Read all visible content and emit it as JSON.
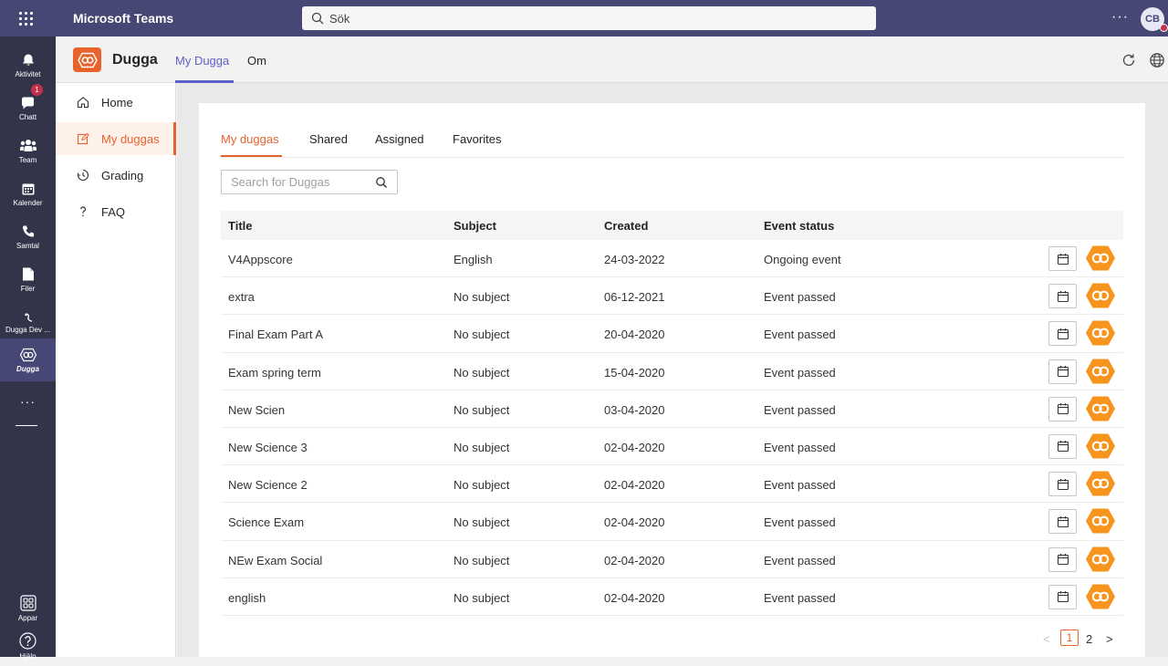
{
  "topbar": {
    "app_title": "Microsoft Teams",
    "search_placeholder": "Sök",
    "more": "···",
    "avatar_initials": "CB"
  },
  "rail": {
    "items": [
      {
        "label": "Aktivitet",
        "icon": "bell-icon"
      },
      {
        "label": "Chatt",
        "icon": "chat-icon",
        "badge": "1"
      },
      {
        "label": "Team",
        "icon": "team-icon"
      },
      {
        "label": "Kalender",
        "icon": "calendar-icon"
      },
      {
        "label": "Samtal",
        "icon": "phone-icon"
      },
      {
        "label": "Filer",
        "icon": "file-icon"
      },
      {
        "label": "Dugga Dev ...",
        "icon": "dugga-dev-icon"
      },
      {
        "label": "Dugga",
        "icon": "dugga-icon"
      }
    ],
    "more": "···",
    "apps_label": "Appar",
    "help_label": "Hjälp"
  },
  "apphead": {
    "name": "Dugga",
    "tabs": [
      "My Dugga",
      "Om"
    ]
  },
  "sidenav": {
    "items": [
      {
        "label": "Home",
        "icon": "home-icon"
      },
      {
        "label": "My duggas",
        "icon": "edit-icon"
      },
      {
        "label": "Grading",
        "icon": "clock-icon"
      },
      {
        "label": "FAQ",
        "icon": "question-icon"
      }
    ]
  },
  "main": {
    "tabs": [
      "My duggas",
      "Shared",
      "Assigned",
      "Favorites"
    ],
    "search_placeholder": "Search for Duggas",
    "columns": [
      "Title",
      "Subject",
      "Created",
      "Event status"
    ],
    "rows": [
      {
        "title": "V4Appscore",
        "subject": "English",
        "created": "24-03-2022",
        "status": "Ongoing event"
      },
      {
        "title": "extra",
        "subject": "No subject",
        "created": "06-12-2021",
        "status": "Event passed"
      },
      {
        "title": "Final Exam Part A",
        "subject": "No subject",
        "created": "20-04-2020",
        "status": "Event passed"
      },
      {
        "title": "Exam spring term",
        "subject": "No subject",
        "created": "15-04-2020",
        "status": "Event passed"
      },
      {
        "title": "New Scien",
        "subject": "No subject",
        "created": "03-04-2020",
        "status": "Event passed"
      },
      {
        "title": "New Science 3",
        "subject": "No subject",
        "created": "02-04-2020",
        "status": "Event passed"
      },
      {
        "title": "New Science 2",
        "subject": "No subject",
        "created": "02-04-2020",
        "status": "Event passed"
      },
      {
        "title": "Science Exam",
        "subject": "No subject",
        "created": "02-04-2020",
        "status": "Event passed"
      },
      {
        "title": "NEw Exam Social",
        "subject": "No subject",
        "created": "02-04-2020",
        "status": "Event passed"
      },
      {
        "title": "english",
        "subject": "No subject",
        "created": "02-04-2020",
        "status": "Event passed"
      }
    ],
    "pager": {
      "prev": "<",
      "pages": [
        "1",
        "2"
      ],
      "next": ">"
    }
  },
  "colors": {
    "teams_purple": "#464775",
    "rail_dark": "#33344a",
    "accent_orange": "#e8622c",
    "teams_tab_blue": "#5b5fc7"
  }
}
